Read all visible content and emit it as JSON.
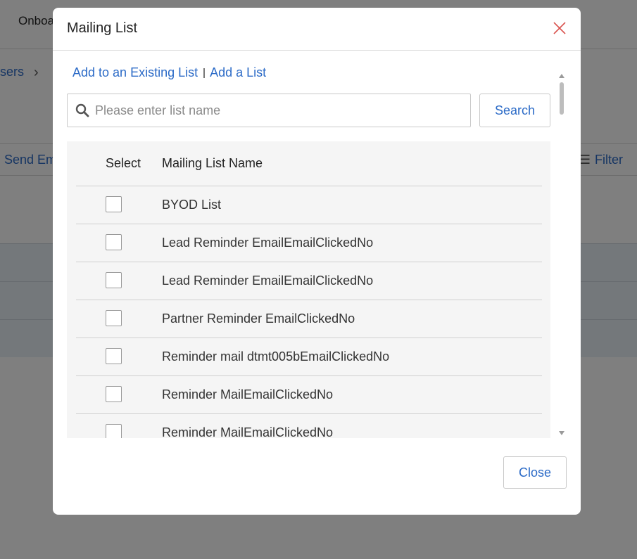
{
  "background": {
    "app_title": "Onboa",
    "breadcrumb_text": "sers",
    "send_label": "Send Em",
    "filter_label": "Filter"
  },
  "modal": {
    "title": "Mailing List",
    "tabs": [
      {
        "label": "Add to an Existing List"
      },
      {
        "label": "Add a List"
      }
    ],
    "search": {
      "placeholder": "Please enter list name",
      "value": "",
      "button_label": "Search"
    },
    "table": {
      "headers": {
        "select": "Select",
        "name": "Mailing List Name"
      },
      "rows": [
        {
          "name": "BYOD List",
          "checked": false
        },
        {
          "name": "Lead Reminder EmailEmailClickedNo",
          "checked": false
        },
        {
          "name": "Lead Reminder EmailEmailClickedNo",
          "checked": false
        },
        {
          "name": "Partner Reminder EmailClickedNo",
          "checked": false
        },
        {
          "name": "Reminder mail dtmt005bEmailClickedNo",
          "checked": false
        },
        {
          "name": "Reminder MailEmailClickedNo",
          "checked": false
        },
        {
          "name": "Reminder MailEmailClickedNo",
          "checked": false
        }
      ]
    },
    "close_label": "Close"
  },
  "colors": {
    "link": "#2c6bc7",
    "close_icon": "#d9534f",
    "overlay": "rgba(0,0,0,0.5)"
  },
  "icons": {
    "close": "close-icon",
    "search": "search-icon",
    "chevron": "chevron-right-icon",
    "filter": "filter-icon"
  }
}
